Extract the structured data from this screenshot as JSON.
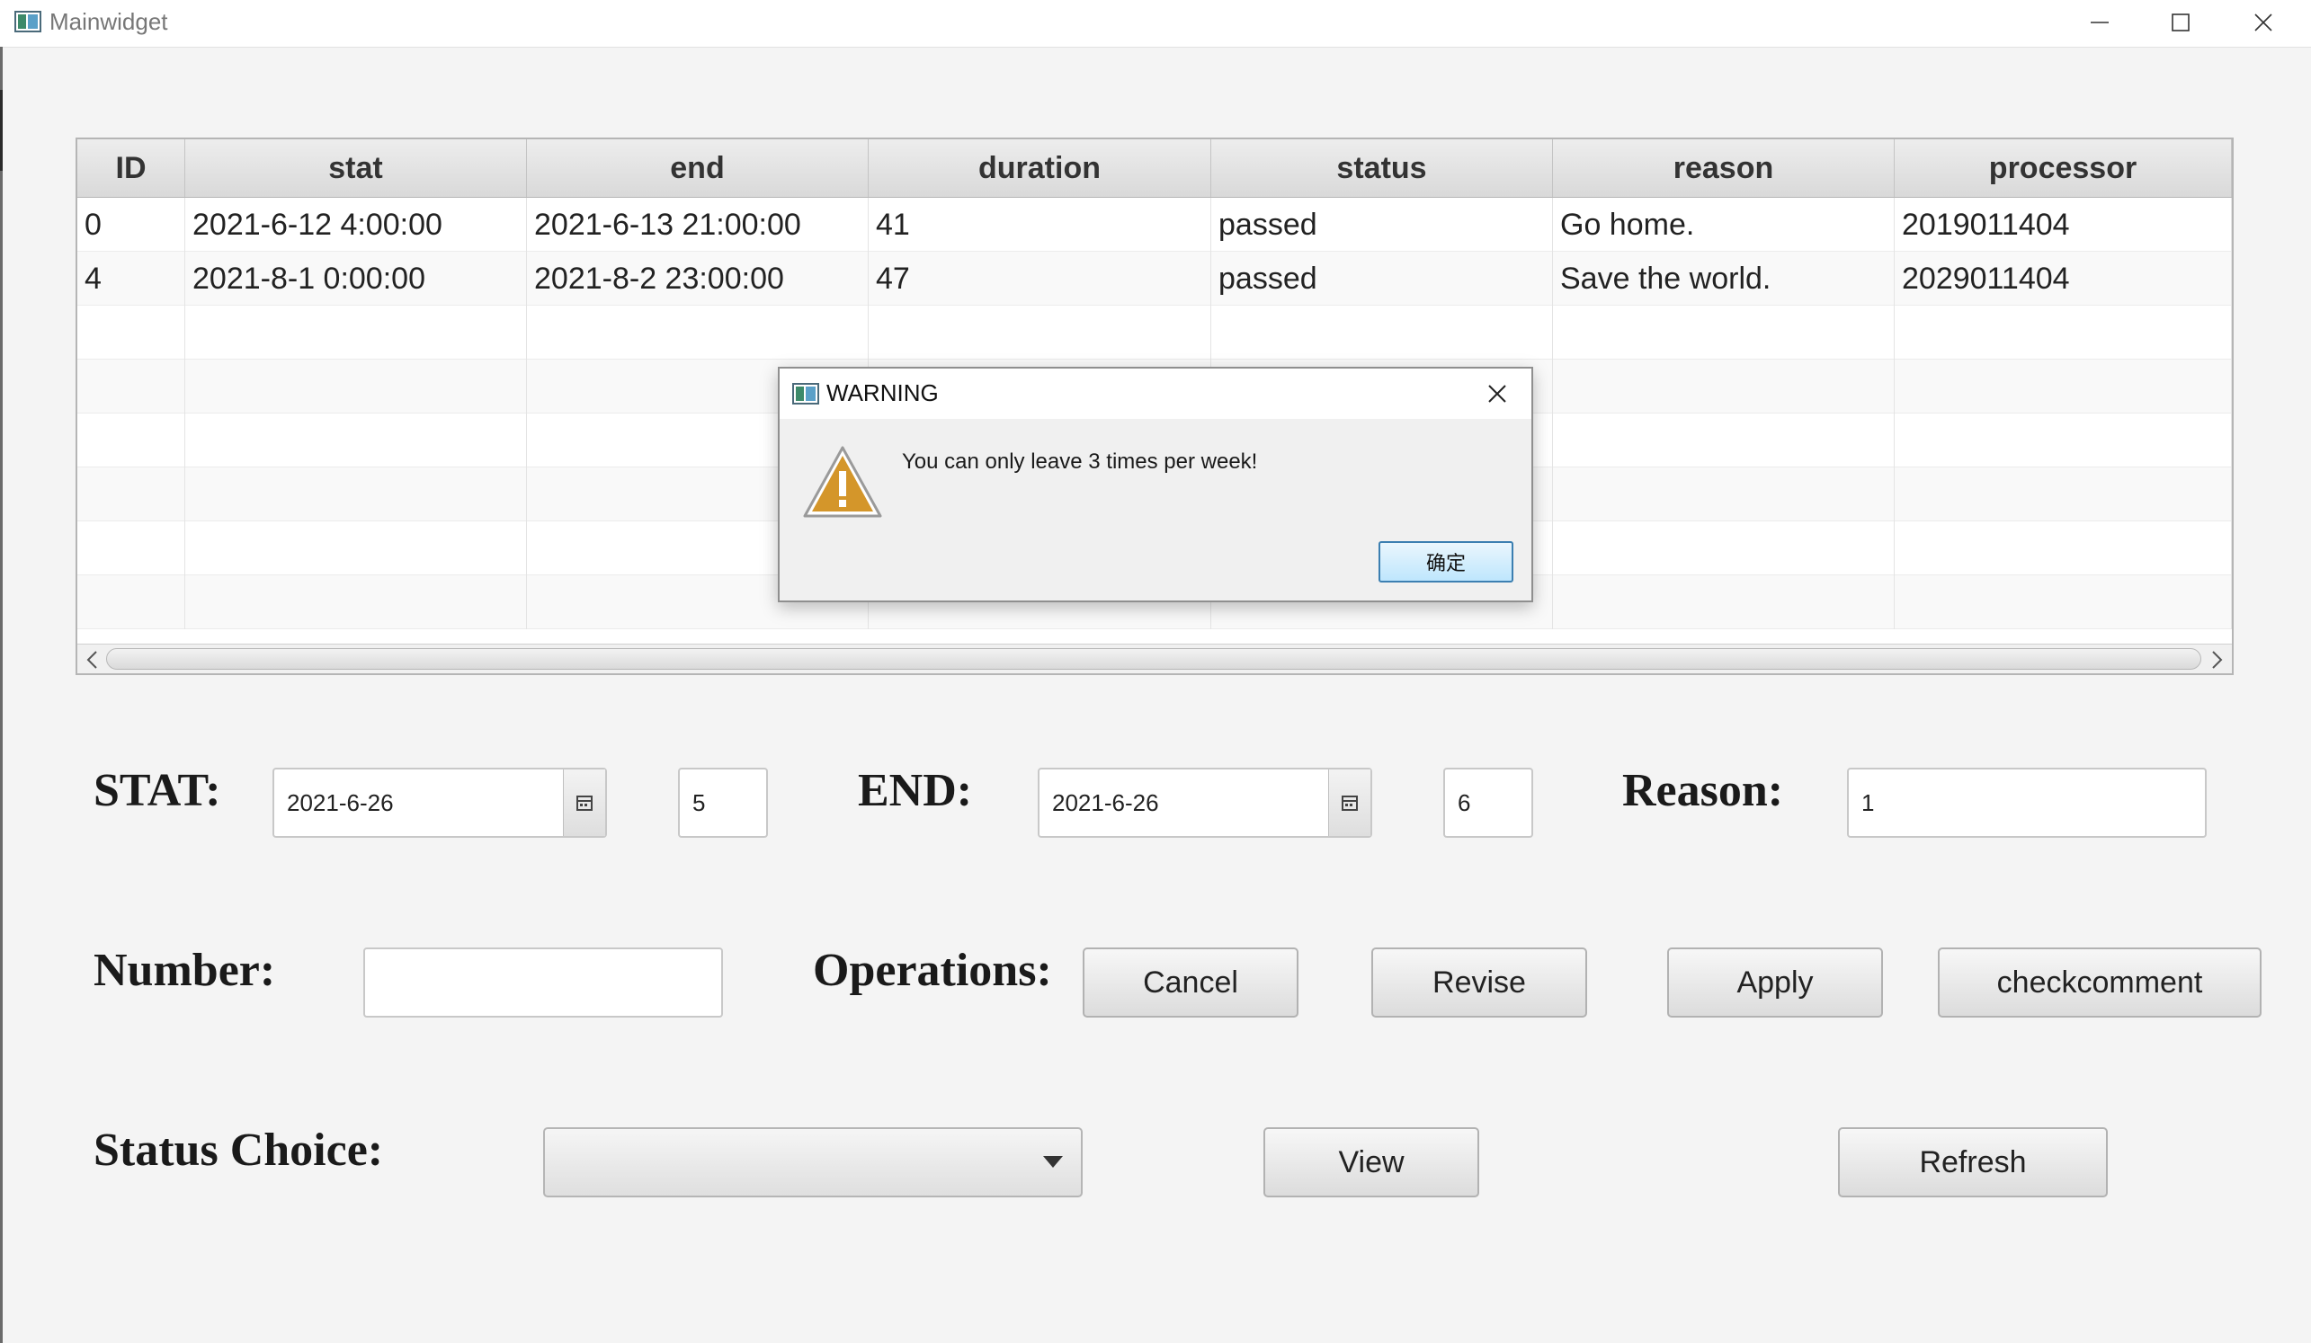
{
  "window": {
    "title": "Mainwidget"
  },
  "table": {
    "columns": [
      "ID",
      "stat",
      "end",
      "duration",
      "status",
      "reason",
      "processor"
    ],
    "rows": [
      [
        "0",
        "2021-6-12 4:00:00",
        "2021-6-13 21:00:00",
        "41",
        "passed",
        "Go home.",
        "2019011404"
      ],
      [
        "4",
        "2021-8-1 0:00:00",
        "2021-8-2 23:00:00",
        "47",
        "passed",
        "Save the world.",
        "2029011404"
      ]
    ]
  },
  "form": {
    "stat_label": "STAT:",
    "stat_date": "2021-6-26",
    "stat_hour": "5",
    "end_label": "END:",
    "end_date": "2021-6-26",
    "end_hour": "6",
    "reason_label": "Reason:",
    "reason_value": "1",
    "number_label": "Number:",
    "number_value": "",
    "operations_label": "Operations:",
    "buttons": {
      "cancel": "Cancel",
      "revise": "Revise",
      "apply": "Apply",
      "checkcomment": "checkcomment",
      "view": "View",
      "refresh": "Refresh"
    },
    "status_choice_label": "Status Choice:",
    "status_choice_value": ""
  },
  "dialog": {
    "title": "WARNING",
    "message": "You can only leave 3 times per week!",
    "ok_label": "确定"
  },
  "icons": [
    "app-icon",
    "minimize-icon",
    "maximize-icon",
    "close-icon",
    "calendar-icon",
    "chevron-down-icon",
    "warning-icon",
    "scroll-left-icon",
    "scroll-right-icon"
  ],
  "colors": {
    "warning": "#d4962a",
    "dialog_ok_border": "#3c7fb1"
  }
}
